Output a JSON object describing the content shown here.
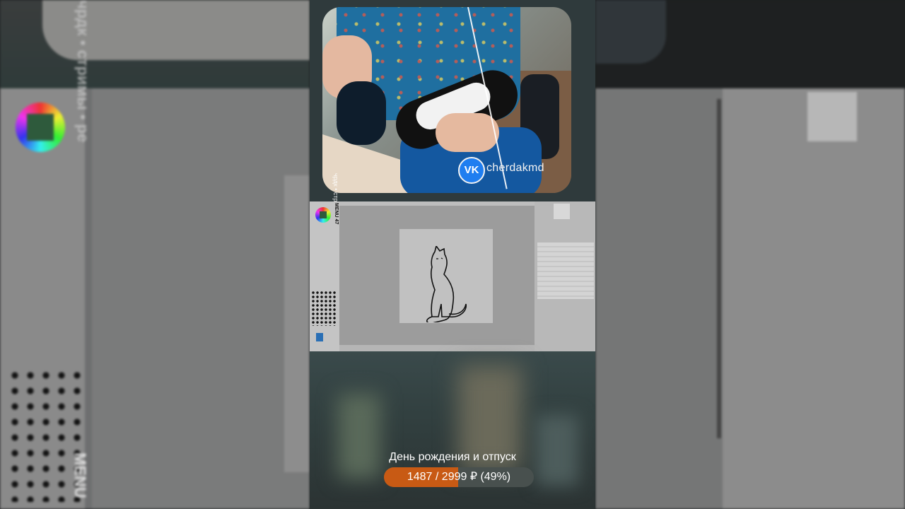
{
  "stream": {
    "channel_handle": "cherdakmd",
    "platform_badge": "VK",
    "side_caption": "чрдк • стримы • ре"
  },
  "screen_capture": {
    "sidebar_label": "MENU 47"
  },
  "background": {
    "left_caption": "чрдк • стримы • ре",
    "menu_caption": "MENU"
  },
  "donation_goal": {
    "title": "День рождения и отпуск",
    "progress_text": "1487 / 2999 ₽ (49%)",
    "current": 1487,
    "target": 2999,
    "percent": 49,
    "fill_color": "#c85a14",
    "track_color": "#48504e"
  },
  "icons": [
    "vk-logo-icon",
    "color-wheel-icon"
  ]
}
